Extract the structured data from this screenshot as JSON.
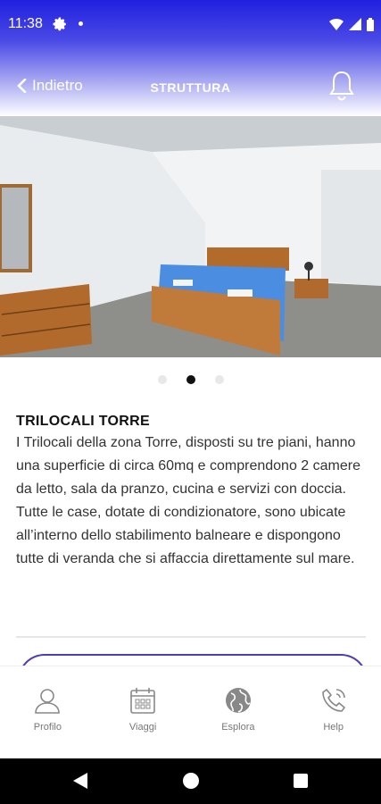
{
  "status_bar": {
    "time": "11:38",
    "icons": [
      "gear-icon",
      "dot-icon",
      "wifi-icon",
      "signal-icon",
      "battery-icon"
    ]
  },
  "header": {
    "back_label": "Indietro",
    "title": "STRUTTURA",
    "bell_icon": "bell-icon",
    "gradient_top": "#2020e0"
  },
  "carousel": {
    "slides": 3,
    "active_index": 1
  },
  "content": {
    "heading": "TRILOCALI TORRE",
    "description": "I Trilocali della zona Torre, disposti su tre piani, hanno una superficie di circa 60mq e comprendono 2 camere da letto, sala da pranzo, cucina e servizi con doccia. Tutte le case, dotate di condizionatore, sono ubicate all’interno dello stabilimento balneare e dispongono tutte di veranda che si affaccia direttamente sul mare."
  },
  "tabbar": {
    "items": [
      {
        "label": "Profilo",
        "icon": "user-icon"
      },
      {
        "label": "Viaggi",
        "icon": "calendar-icon"
      },
      {
        "label": "Esplora",
        "icon": "globe-icon"
      },
      {
        "label": "Help",
        "icon": "phone-icon"
      }
    ]
  },
  "colors": {
    "accent": "#4a3fb5",
    "primary": "#2020e0"
  }
}
